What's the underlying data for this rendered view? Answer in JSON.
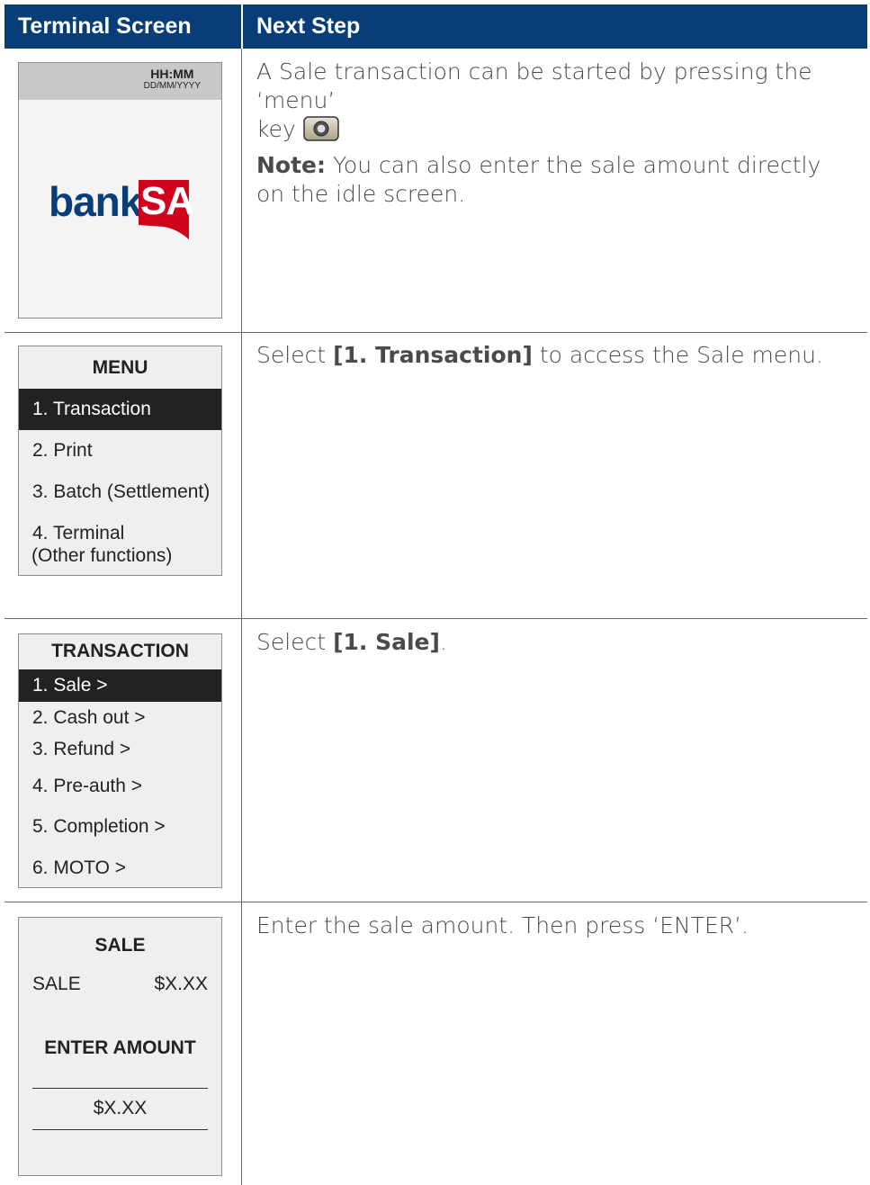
{
  "header": {
    "left": "Terminal Screen",
    "right": "Next Step"
  },
  "rows": [
    {
      "screen": {
        "time": "HH:MM",
        "date": "DD/MM/YYYY",
        "logo_text_left": "bank",
        "logo_text_right": "SA"
      },
      "step": {
        "line1": "A Sale transaction can be started by pressing the ‘menu’",
        "line2": "key",
        "note_label": "Note:",
        "note_text_1": "You can also enter the sale amount directly",
        "note_text_2": "on the idle screen."
      },
      "icons": [
        "menu-key-icon"
      ]
    },
    {
      "screen": {
        "title": "MENU",
        "items": [
          {
            "label": "1. Transaction",
            "selected": true
          },
          {
            "label": "2. Print",
            "selected": false
          },
          {
            "label": "3. Batch (Settlement)",
            "selected": false
          },
          {
            "label": "4. Terminal",
            "selected": false
          },
          {
            "label": "(Other functions)",
            "selected": false
          }
        ]
      },
      "step": {
        "prefix": "Select",
        "bold": "[1. Transaction]",
        "suffix": "to access the Sale menu."
      }
    },
    {
      "screen": {
        "title": "TRANSACTION",
        "items": [
          {
            "label": "1. Sale >",
            "selected": true
          },
          {
            "label": "2. Cash out >",
            "selected": false
          },
          {
            "label": "3. Refund >",
            "selected": false
          },
          {
            "label": "4. Pre-auth >",
            "selected": false
          },
          {
            "label": "5. Completion >",
            "selected": false
          },
          {
            "label": "6. MOTO >",
            "selected": false
          }
        ]
      },
      "step": {
        "prefix": "Select",
        "bold": "[1. Sale]",
        "suffix": "."
      }
    },
    {
      "screen": {
        "title": "SALE",
        "sale_label": "SALE",
        "sale_value": "$X.XX",
        "prompt": "ENTER AMOUNT",
        "amount": "$X.XX"
      },
      "step": {
        "text": "Enter the sale amount. Then press ‘ENTER’."
      }
    }
  ],
  "colors": {
    "header_bg": "#073e78",
    "bank_blue": "#073e78",
    "sa_red": "#d0021b",
    "selected_bg": "#222222"
  }
}
